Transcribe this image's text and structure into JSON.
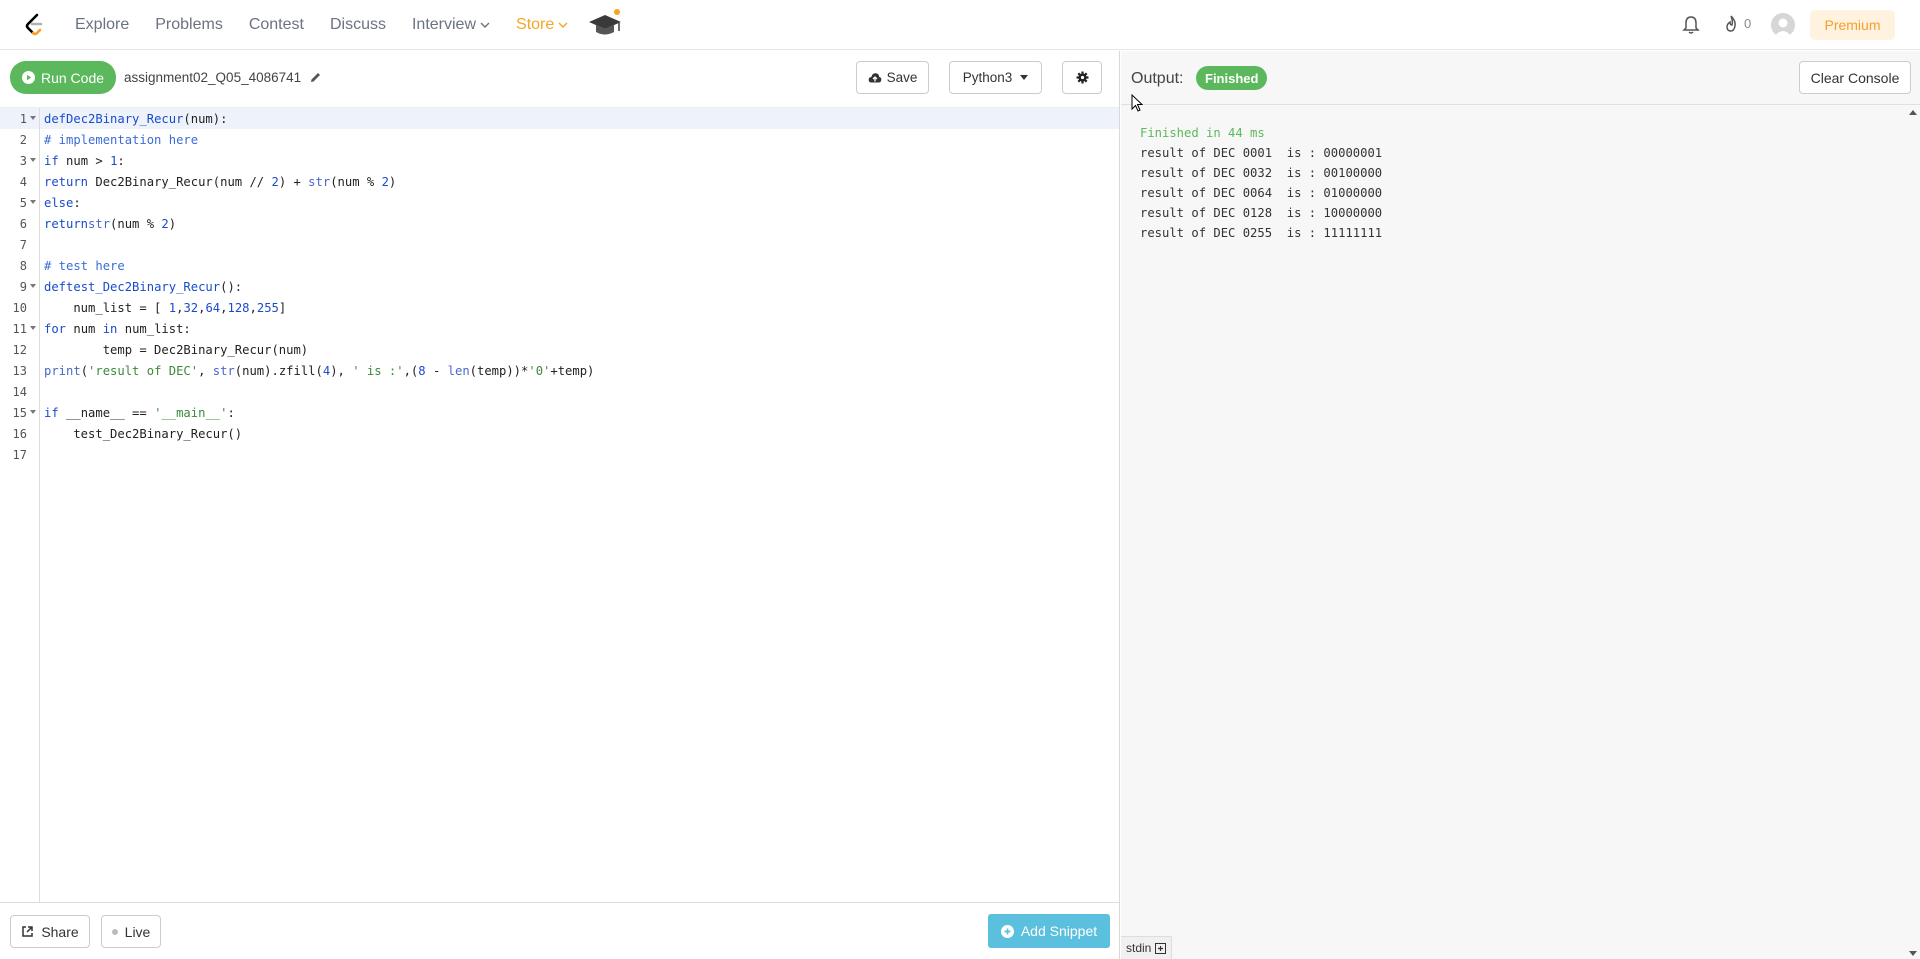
{
  "nav": {
    "links": [
      {
        "label": "Explore"
      },
      {
        "label": "Problems"
      },
      {
        "label": "Contest"
      },
      {
        "label": "Discuss"
      },
      {
        "label": "Interview"
      },
      {
        "label": "Store"
      }
    ],
    "fire_count": "0",
    "premium_label": "Premium"
  },
  "editor": {
    "run_label": "Run Code",
    "filename": "assignment02_Q05_4086741",
    "save_label": "Save",
    "language": "Python3",
    "line_numbers": [
      "1",
      "2",
      "3",
      "4",
      "5",
      "6",
      "7",
      "8",
      "9",
      "10",
      "11",
      "12",
      "13",
      "14",
      "15",
      "16",
      "17"
    ],
    "code_lines": [
      "def Dec2Binary_Recur(num):",
      "    # implementation here",
      "    if num > 1:",
      "        return Dec2Binary_Recur(num // 2) + str(num % 2)",
      "    else:",
      "        return str(num % 2)",
      "",
      "# test here",
      "def test_Dec2Binary_Recur():",
      "    num_list = [ 1,32,64,128,255]",
      "    for num in num_list:",
      "        temp = Dec2Binary_Recur(num)",
      "        print('result of DEC', str(num).zfill(4), ' is :',(8 - len(temp))*'0'+temp)",
      "",
      "if __name__ == '__main__':",
      "    test_Dec2Binary_Recur()",
      ""
    ],
    "share_label": "Share",
    "live_label": "Live",
    "snippet_label": "Add Snippet"
  },
  "output": {
    "label": "Output:",
    "status_badge": "Finished",
    "clear_label": "Clear Console",
    "status_line": "Finished in 44 ms",
    "lines": [
      "result of DEC 0001  is : 00000001",
      "result of DEC 0032  is : 00100000",
      "result of DEC 0064  is : 01000000",
      "result of DEC 0128  is : 10000000",
      "result of DEC 0255  is : 11111111"
    ],
    "stdin_label": "stdin"
  },
  "colors": {
    "run_green": "#5cb85c",
    "store_orange": "#f5a623",
    "snippet_blue": "#5bc0de",
    "premium_bg": "#fff3e0"
  }
}
